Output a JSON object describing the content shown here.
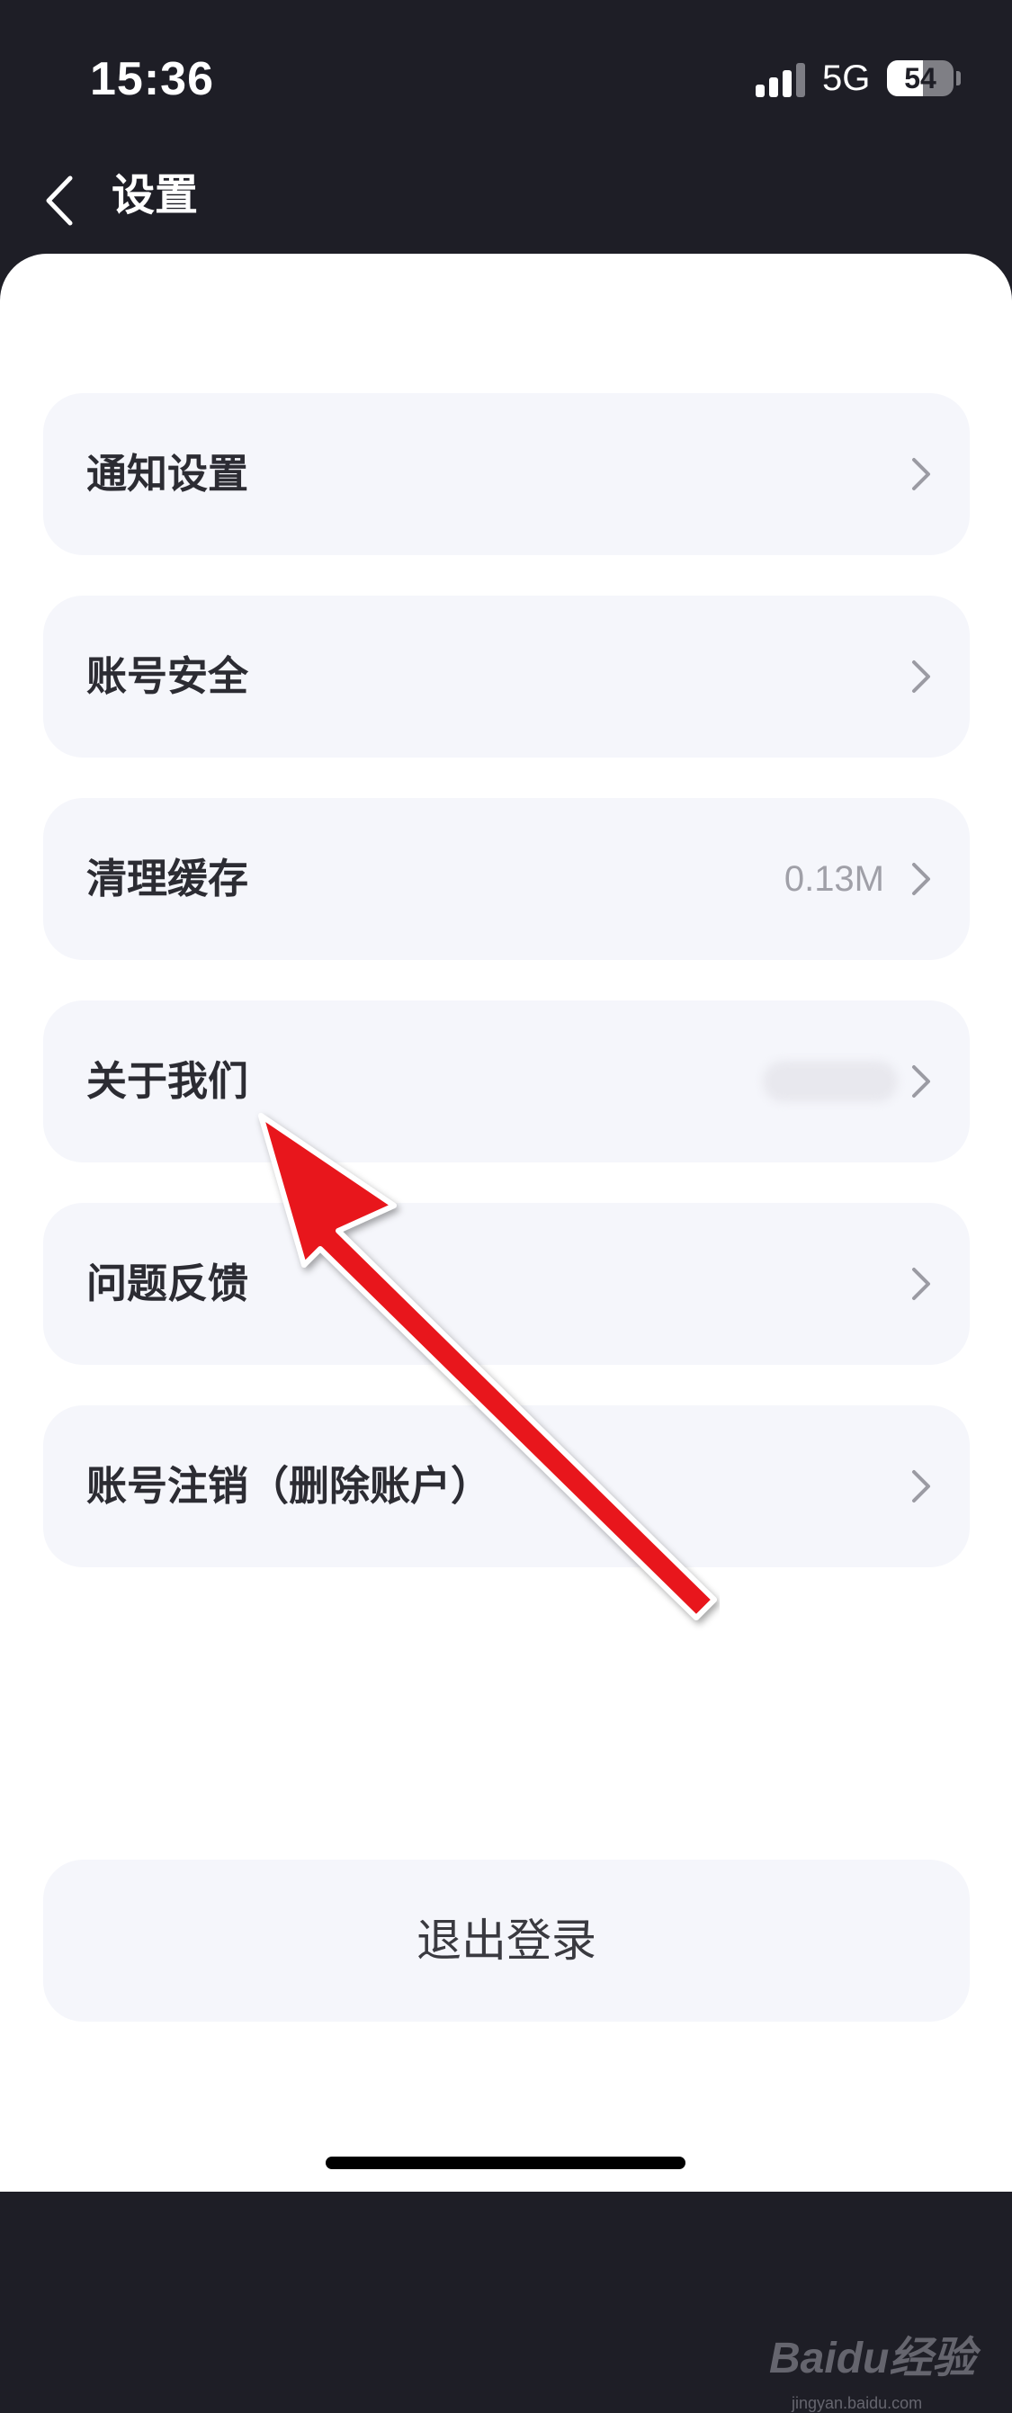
{
  "status_bar": {
    "time": "15:36",
    "network": "5G",
    "battery": "54",
    "battery_level_percent": 54
  },
  "nav": {
    "title": "设置",
    "back_icon": "chevron-left-icon"
  },
  "settings": [
    {
      "label": "通知设置",
      "value": ""
    },
    {
      "label": "账号安全",
      "value": ""
    },
    {
      "label": "清理缓存",
      "value": "0.13M"
    },
    {
      "label": "关于我们",
      "value": "",
      "value_blurred": true
    },
    {
      "label": "问题反馈",
      "value": ""
    },
    {
      "label": "账号注销（删除账户）",
      "value": ""
    }
  ],
  "logout": {
    "label": "退出登录"
  },
  "watermark": {
    "text": "Baidu经验",
    "sub": "jingyan.baidu.com"
  },
  "colors": {
    "header_bg": "#1e1e26",
    "row_bg": "#f5f6fb",
    "annotation_arrow": "#e8141a"
  }
}
